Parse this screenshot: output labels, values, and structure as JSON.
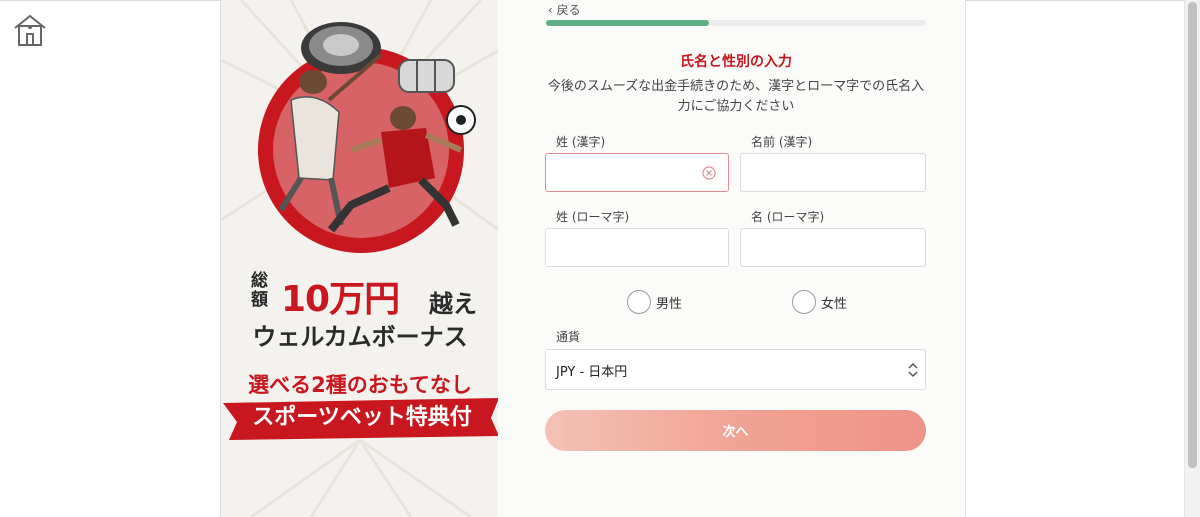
{
  "nav": {
    "back_label": "戻る"
  },
  "progress": {
    "fraction": 0.43
  },
  "form": {
    "title": "氏名と性別の入力",
    "description": "今後のスムーズな出金手続きのため、漢字とローマ字での氏名入力にご協力ください",
    "fields": {
      "last_name_kanji": {
        "label": "姓 (漢字)",
        "value": ""
      },
      "first_name_kanji": {
        "label": "名前 (漢字)",
        "value": ""
      },
      "last_name_roman": {
        "label": "姓 (ローマ字)",
        "value": ""
      },
      "first_name_roman": {
        "label": "名 (ローマ字)",
        "value": ""
      }
    },
    "gender": {
      "male": "男性",
      "female": "女性"
    },
    "currency": {
      "label": "通貨",
      "value": "JPY - 日本円"
    },
    "next_label": "次へ"
  },
  "promo": {
    "total": "総額",
    "amount": "10万円",
    "over": "越え",
    "welcome": "ウェルカムボーナス",
    "choose": "選べる2種のおもてなし",
    "sports": "スポーツベット特典付"
  },
  "colors": {
    "accent": "#c8171e",
    "progress": "#5fae84",
    "button": "#ee9488"
  },
  "icons": [
    "home-icon",
    "chevron-left-icon",
    "clear-icon",
    "select-arrows-icon"
  ]
}
